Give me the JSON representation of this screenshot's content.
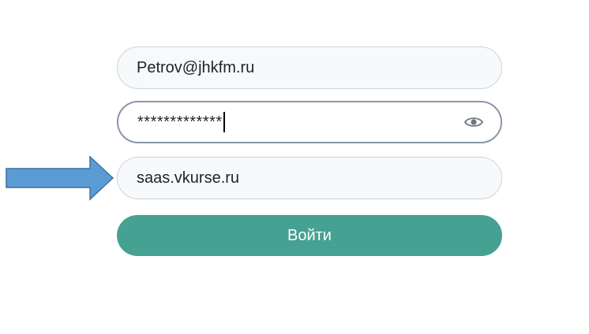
{
  "login_form": {
    "email_value": "Petrov@jhkfm.ru",
    "password_value": "*************",
    "server_value": "saas.vkurse.ru",
    "submit_label": "Войти"
  },
  "icons": {
    "password_toggle": "eye-icon",
    "pointer": "arrow-right-icon"
  },
  "colors": {
    "accent": "#45A192",
    "field_border": "#C9D6E0",
    "active_border": "#8A96A8",
    "arrow_fill": "#5B9BD5",
    "arrow_stroke": "#41719C"
  }
}
